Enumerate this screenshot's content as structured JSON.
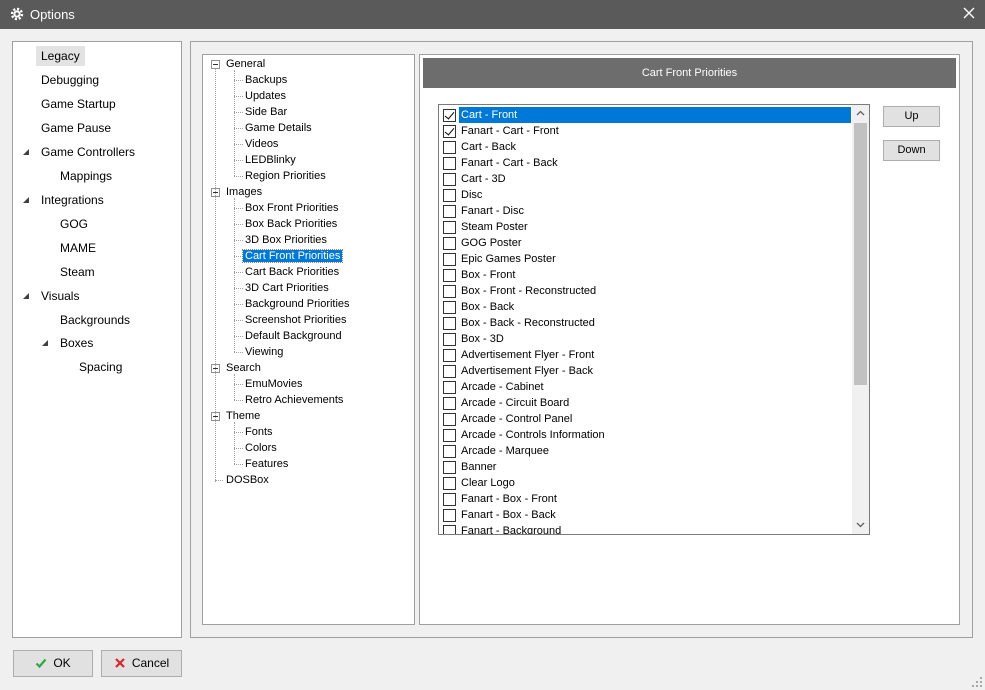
{
  "window": {
    "title": "Options",
    "icon": "gear-icon",
    "close_icon": "close-icon"
  },
  "sidebar": {
    "items": [
      {
        "label": "Legacy",
        "selected": true
      },
      {
        "label": "Debugging"
      },
      {
        "label": "Game Startup"
      },
      {
        "label": "Game Pause"
      },
      {
        "label": "Game Controllers",
        "expanded": true
      },
      {
        "label": "Mappings"
      },
      {
        "label": "Integrations",
        "expanded": true
      },
      {
        "label": "GOG"
      },
      {
        "label": "MAME"
      },
      {
        "label": "Steam"
      },
      {
        "label": "Visuals",
        "expanded": true
      },
      {
        "label": "Backgrounds"
      },
      {
        "label": "Boxes",
        "expanded": true
      },
      {
        "label": "Spacing"
      }
    ]
  },
  "tree": {
    "nodes": [
      {
        "label": "General",
        "parent": true
      },
      {
        "label": "Backups"
      },
      {
        "label": "Updates"
      },
      {
        "label": "Side Bar"
      },
      {
        "label": "Game Details"
      },
      {
        "label": "Videos"
      },
      {
        "label": "LEDBlinky"
      },
      {
        "label": "Region Priorities"
      },
      {
        "label": "Images",
        "parent": true
      },
      {
        "label": "Box Front Priorities"
      },
      {
        "label": "Box Back Priorities"
      },
      {
        "label": "3D Box Priorities"
      },
      {
        "label": "Cart Front Priorities",
        "selected": true
      },
      {
        "label": "Cart Back Priorities"
      },
      {
        "label": "3D Cart Priorities"
      },
      {
        "label": "Background Priorities"
      },
      {
        "label": "Screenshot Priorities"
      },
      {
        "label": "Default Background"
      },
      {
        "label": "Viewing"
      },
      {
        "label": "Search",
        "parent": true
      },
      {
        "label": "EmuMovies"
      },
      {
        "label": "Retro Achievements"
      },
      {
        "label": "Theme",
        "parent": true
      },
      {
        "label": "Fonts"
      },
      {
        "label": "Colors"
      },
      {
        "label": "Features"
      },
      {
        "label": "DOSBox",
        "parent": true,
        "leaf": true
      }
    ]
  },
  "detail": {
    "header": "Cart Front Priorities",
    "priorities": [
      {
        "label": "Cart - Front",
        "checked": true,
        "selected": true
      },
      {
        "label": "Fanart - Cart - Front",
        "checked": true
      },
      {
        "label": "Cart - Back"
      },
      {
        "label": "Fanart - Cart - Back"
      },
      {
        "label": "Cart - 3D"
      },
      {
        "label": "Disc"
      },
      {
        "label": "Fanart - Disc"
      },
      {
        "label": "Steam Poster"
      },
      {
        "label": "GOG Poster"
      },
      {
        "label": "Epic Games Poster"
      },
      {
        "label": "Box - Front"
      },
      {
        "label": "Box - Front - Reconstructed"
      },
      {
        "label": "Box - Back"
      },
      {
        "label": "Box - Back - Reconstructed"
      },
      {
        "label": "Box - 3D"
      },
      {
        "label": "Advertisement Flyer - Front"
      },
      {
        "label": "Advertisement Flyer - Back"
      },
      {
        "label": "Arcade - Cabinet"
      },
      {
        "label": "Arcade - Circuit Board"
      },
      {
        "label": "Arcade - Control Panel"
      },
      {
        "label": "Arcade - Controls Information"
      },
      {
        "label": "Arcade - Marquee"
      },
      {
        "label": "Banner"
      },
      {
        "label": "Clear Logo"
      },
      {
        "label": "Fanart - Box - Front"
      },
      {
        "label": "Fanart - Box - Back"
      },
      {
        "label": "Fanart - Background"
      }
    ],
    "up_label": "Up",
    "down_label": "Down"
  },
  "footer": {
    "ok_label": "OK",
    "ok_icon": "checkmark-icon",
    "cancel_label": "Cancel",
    "cancel_icon": "cross-icon"
  },
  "colors": {
    "titlebar": "#5a5a5a",
    "selection": "#0078d7",
    "header_bar": "#6d6d6d"
  }
}
